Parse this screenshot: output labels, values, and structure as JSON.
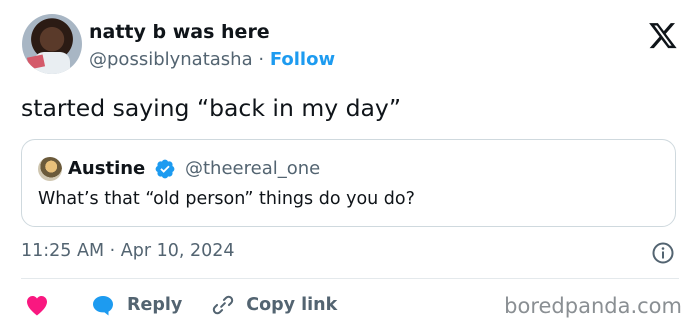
{
  "author": {
    "name": "natty b was here",
    "handle": "@possiblynatasha",
    "separator": "·",
    "follow_label": "Follow"
  },
  "tweet": {
    "text": "started saying “back in my day”",
    "timestamp": "11:25 AM · Apr 10, 2024"
  },
  "quoted": {
    "name": "Austine",
    "handle": "@theereal_one",
    "text": "What’s that “old person” things do you do?"
  },
  "actions": {
    "reply_label": "Reply",
    "copy_link_label": "Copy link"
  },
  "watermark": "boredpanda.com",
  "colors": {
    "accent": "#1d9bf0",
    "heart": "#f91880",
    "text": "#0f1419",
    "muted": "#536471"
  },
  "icons": [
    "x-logo-icon",
    "verified-badge-icon",
    "info-icon",
    "heart-icon",
    "reply-icon",
    "link-icon"
  ]
}
